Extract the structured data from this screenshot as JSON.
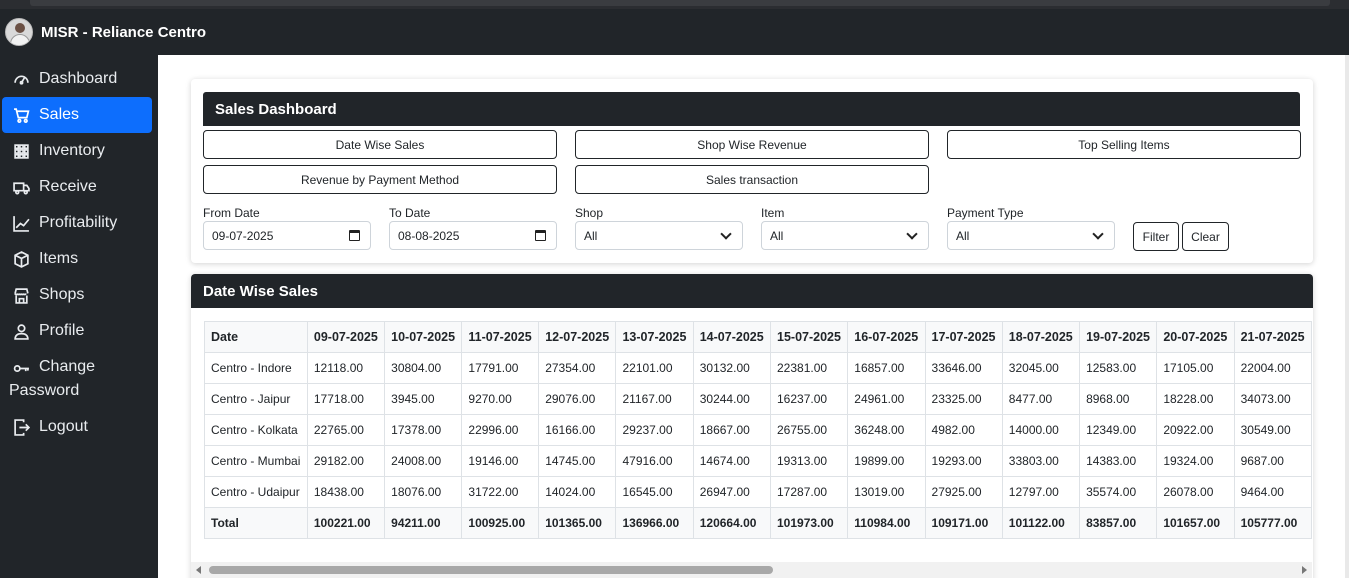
{
  "app": {
    "title": "MISR - Reliance Centro"
  },
  "sidebar": {
    "items": [
      {
        "label": "Dashboard",
        "icon": "speedometer-icon"
      },
      {
        "label": "Sales",
        "icon": "cart-icon",
        "active": true
      },
      {
        "label": "Inventory",
        "icon": "grid-icon"
      },
      {
        "label": "Receive",
        "icon": "truck-icon"
      },
      {
        "label": "Profitability",
        "icon": "graph-up-icon"
      },
      {
        "label": "Items",
        "icon": "box-icon"
      },
      {
        "label": "Shops",
        "icon": "shop-icon"
      },
      {
        "label": "Profile",
        "icon": "person-icon"
      },
      {
        "label": "Change Password",
        "icon": "key-icon"
      },
      {
        "label": "Logout",
        "icon": "logout-icon"
      }
    ]
  },
  "dashboard": {
    "title": "Sales Dashboard",
    "report_buttons": [
      "Date Wise Sales",
      "Shop Wise Revenue",
      "Top Selling Items",
      "Revenue by Payment Method",
      "Sales transaction"
    ]
  },
  "filters": {
    "from_date": {
      "label": "From Date",
      "value": "09-07-2025"
    },
    "to_date": {
      "label": "To Date",
      "value": "08-08-2025"
    },
    "shop": {
      "label": "Shop",
      "value": "All"
    },
    "item": {
      "label": "Item",
      "value": "All"
    },
    "payment_type": {
      "label": "Payment Type",
      "value": "All"
    },
    "filter_label": "Filter",
    "clear_label": "Clear"
  },
  "report": {
    "title": "Date Wise Sales",
    "date_header": "Date",
    "dates": [
      "09-07-2025",
      "10-07-2025",
      "11-07-2025",
      "12-07-2025",
      "13-07-2025",
      "14-07-2025",
      "15-07-2025",
      "16-07-2025",
      "17-07-2025",
      "18-07-2025",
      "19-07-2025",
      "20-07-2025",
      "21-07-2025"
    ],
    "rows": [
      {
        "shop": "Centro - Indore",
        "values": [
          "12118.00",
          "30804.00",
          "17791.00",
          "27354.00",
          "22101.00",
          "30132.00",
          "22381.00",
          "16857.00",
          "33646.00",
          "32045.00",
          "12583.00",
          "17105.00",
          "22004.00"
        ]
      },
      {
        "shop": "Centro - Jaipur",
        "values": [
          "17718.00",
          "3945.00",
          "9270.00",
          "29076.00",
          "21167.00",
          "30244.00",
          "16237.00",
          "24961.00",
          "23325.00",
          "8477.00",
          "8968.00",
          "18228.00",
          "34073.00"
        ]
      },
      {
        "shop": "Centro - Kolkata",
        "values": [
          "22765.00",
          "17378.00",
          "22996.00",
          "16166.00",
          "29237.00",
          "18667.00",
          "26755.00",
          "36248.00",
          "4982.00",
          "14000.00",
          "12349.00",
          "20922.00",
          "30549.00"
        ]
      },
      {
        "shop": "Centro - Mumbai",
        "values": [
          "29182.00",
          "24008.00",
          "19146.00",
          "14745.00",
          "47916.00",
          "14674.00",
          "19313.00",
          "19899.00",
          "19293.00",
          "33803.00",
          "14383.00",
          "19324.00",
          "9687.00"
        ]
      },
      {
        "shop": "Centro - Udaipur",
        "values": [
          "18438.00",
          "18076.00",
          "31722.00",
          "14024.00",
          "16545.00",
          "26947.00",
          "17287.00",
          "13019.00",
          "27925.00",
          "12797.00",
          "35574.00",
          "26078.00",
          "9464.00"
        ]
      }
    ],
    "total": {
      "label": "Total",
      "values": [
        "100221.00",
        "94211.00",
        "100925.00",
        "101365.00",
        "136966.00",
        "120664.00",
        "101973.00",
        "110984.00",
        "109171.00",
        "101122.00",
        "83857.00",
        "101657.00",
        "105777.00"
      ]
    }
  },
  "colors": {
    "accent": "#0d6efd",
    "dark": "#212529"
  }
}
